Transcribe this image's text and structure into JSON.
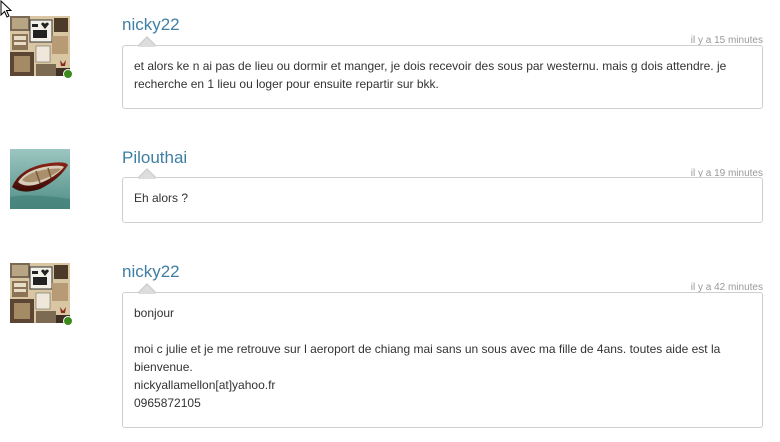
{
  "messages": [
    {
      "username": "nicky22",
      "timestamp": "il y a 15 minutes",
      "avatar": "i-love-ny-collage",
      "online": true,
      "lines": [
        "et alors ke n ai pas de lieu ou dormir et manger, je dois recevoir des sous par westernu. mais g dois attendre. je recherche en 1 lieu ou loger pour ensuite repartir sur bkk."
      ]
    },
    {
      "username": "Pilouthai",
      "timestamp": "il y a 19 minutes",
      "avatar": "rowboat-photo",
      "online": false,
      "lines": [
        "Eh alors ?"
      ]
    },
    {
      "username": "nicky22",
      "timestamp": "il y a 42 minutes",
      "avatar": "i-love-ny-collage",
      "online": true,
      "lines": [
        "bonjour",
        "",
        "moi c julie et je me retrouve sur l aeroport de chiang mai sans un sous avec ma fille de 4ans. toutes aide est la bienvenue.",
        "nickyallamellon[at]yahoo.fr",
        "0965872105"
      ]
    }
  ],
  "colors": {
    "username": "#3f7fa4",
    "timestamp": "#999999",
    "online": "#3c8a1e",
    "border": "#cfcfcf"
  }
}
